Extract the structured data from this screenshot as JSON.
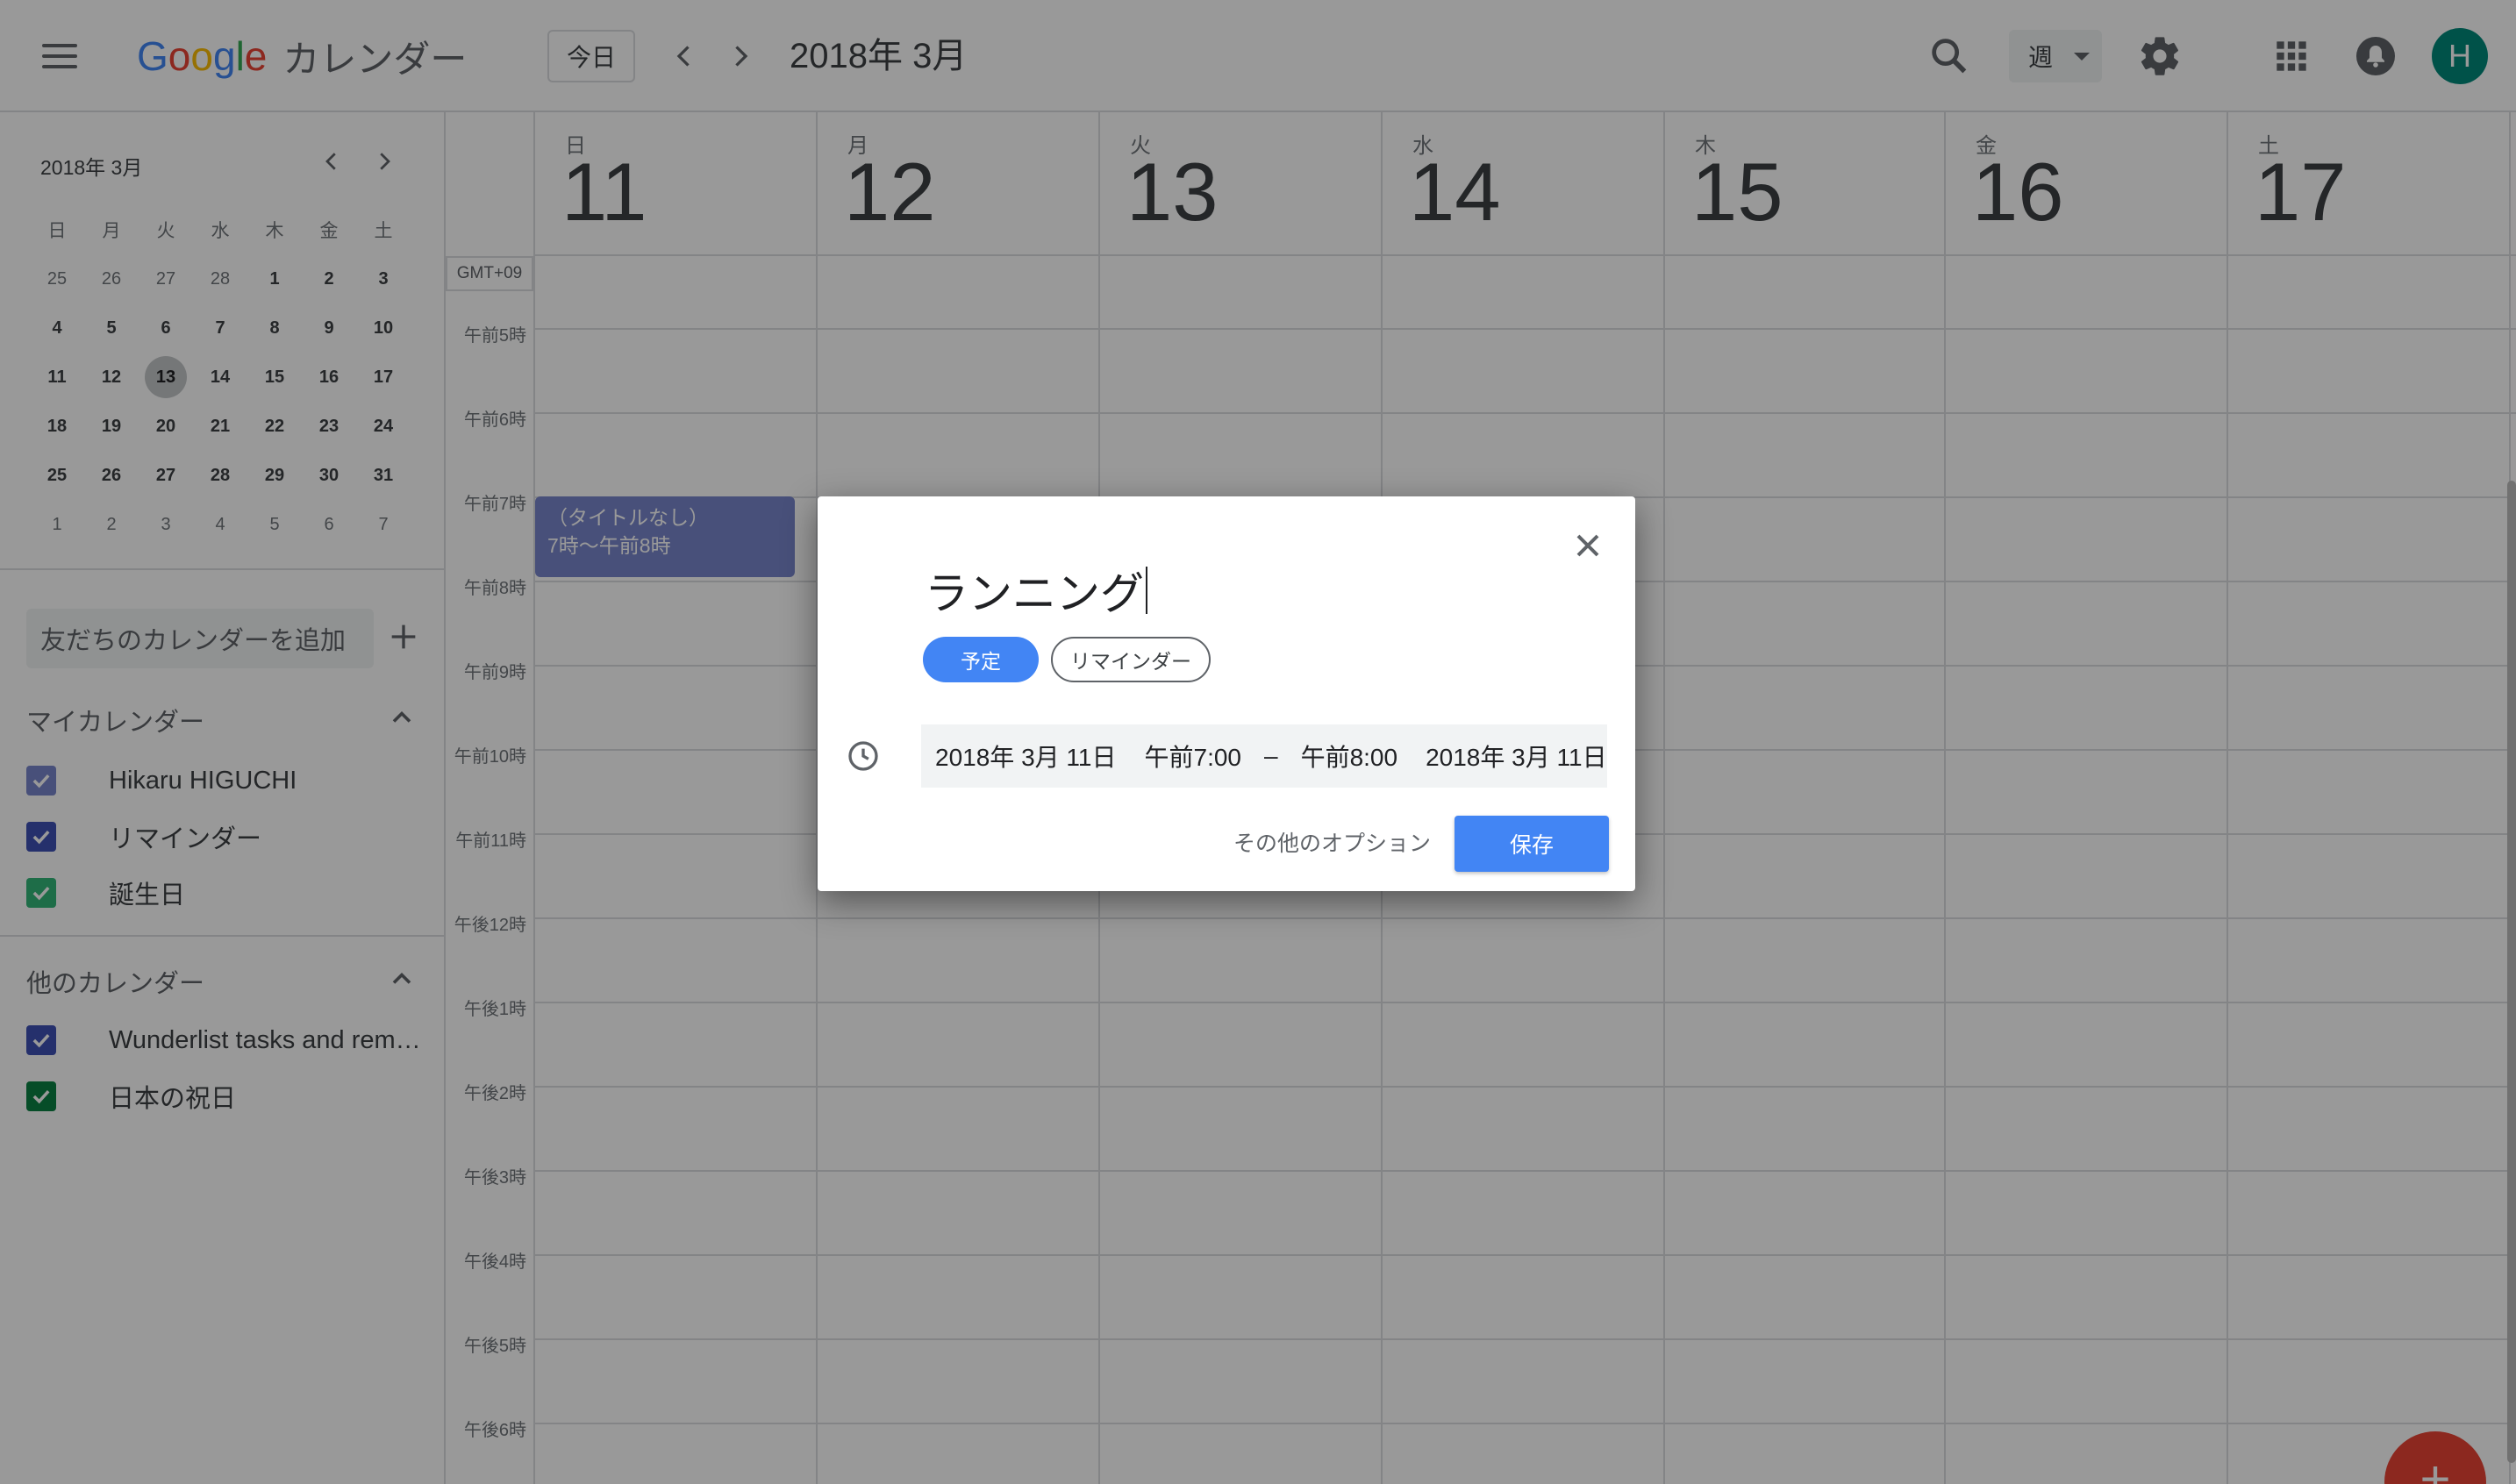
{
  "header": {
    "logo_text": "Google",
    "app_name": "カレンダー",
    "today_label": "今日",
    "period_title": "2018年 3月",
    "view_label": "週",
    "avatar_letter": "H",
    "icons": [
      "menu-icon",
      "chevron-left-icon",
      "chevron-right-icon",
      "search-icon",
      "gear-icon",
      "apps-icon",
      "bell-icon"
    ]
  },
  "mini_calendar": {
    "title": "2018年 3月",
    "dow": [
      "日",
      "月",
      "火",
      "水",
      "木",
      "金",
      "土"
    ],
    "selected": "13",
    "weeks": [
      [
        "25",
        "26",
        "27",
        "28",
        "1",
        "2",
        "3"
      ],
      [
        "4",
        "5",
        "6",
        "7",
        "8",
        "9",
        "10"
      ],
      [
        "11",
        "12",
        "13",
        "14",
        "15",
        "16",
        "17"
      ],
      [
        "18",
        "19",
        "20",
        "21",
        "22",
        "23",
        "24"
      ],
      [
        "25",
        "26",
        "27",
        "28",
        "29",
        "30",
        "31"
      ],
      [
        "1",
        "2",
        "3",
        "4",
        "5",
        "6",
        "7"
      ]
    ]
  },
  "sidebar": {
    "friend_placeholder": "友だちのカレンダーを追加",
    "my_calendars_title": "マイカレンダー",
    "my_calendars": [
      {
        "label": "Hikaru HIGUCHI",
        "color": "#7986cb"
      },
      {
        "label": "リマインダー",
        "color": "#3f51b5"
      },
      {
        "label": "誕生日",
        "color": "#33b679"
      }
    ],
    "other_calendars_title": "他のカレンダー",
    "other_calendars": [
      {
        "label": "Wunderlist tasks and remin...",
        "color": "#3f51b5"
      },
      {
        "label": "日本の祝日",
        "color": "#0b8043"
      }
    ]
  },
  "week": {
    "timezone": "GMT+09",
    "days": [
      {
        "dow": "日",
        "num": "11"
      },
      {
        "dow": "月",
        "num": "12"
      },
      {
        "dow": "火",
        "num": "13"
      },
      {
        "dow": "水",
        "num": "14"
      },
      {
        "dow": "木",
        "num": "15"
      },
      {
        "dow": "金",
        "num": "16"
      },
      {
        "dow": "土",
        "num": "17"
      }
    ],
    "hours": [
      "午前5時",
      "午前6時",
      "午前7時",
      "午前8時",
      "午前9時",
      "午前10時",
      "午前11時",
      "午後12時",
      "午後1時",
      "午後2時",
      "午後3時",
      "午後4時",
      "午後5時",
      "午後6時"
    ],
    "event": {
      "title": "（タイトルなし）",
      "time": "7時〜午前8時"
    },
    "fab_label": "+"
  },
  "dialog": {
    "title_value": "ランニング",
    "chip_event": "予定",
    "chip_reminder": "リマインダー",
    "start_date": "2018年 3月 11日",
    "start_time": "午前7:00",
    "separator": "–",
    "end_time": "午前8:00",
    "end_date": "2018年 3月 11日",
    "more_options": "その他のオプション",
    "save_label": "保存"
  }
}
